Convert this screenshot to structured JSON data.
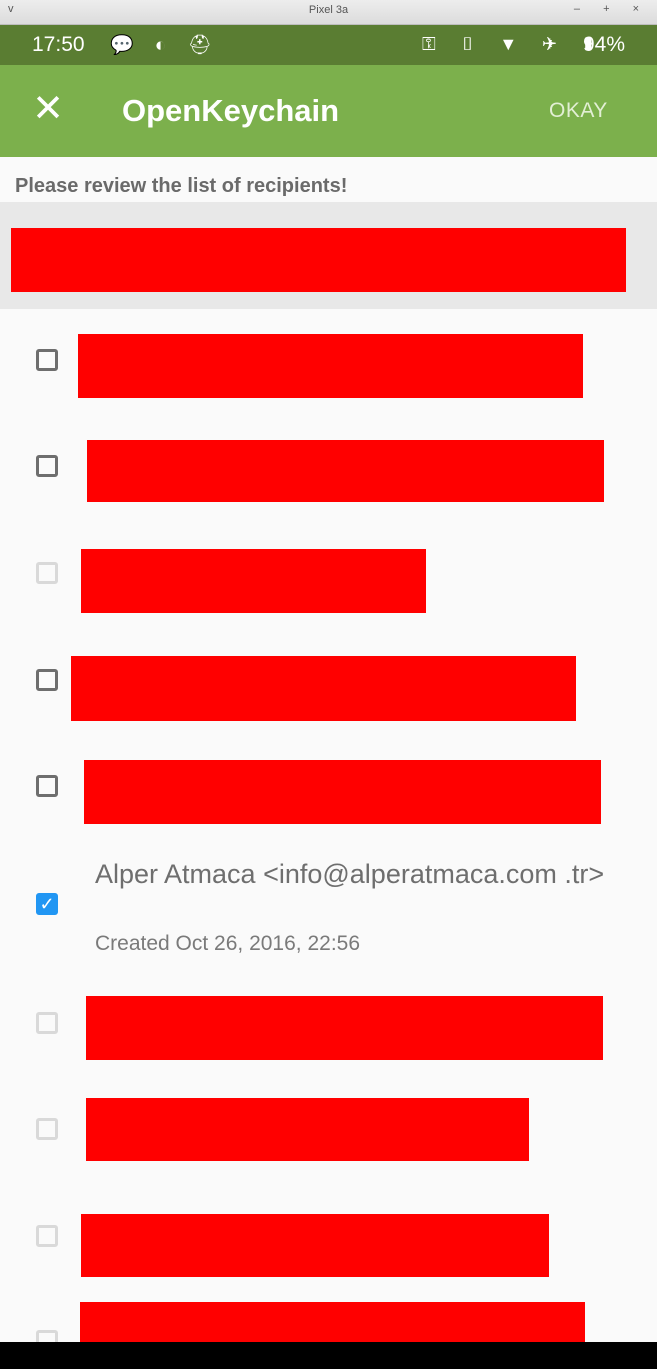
{
  "window": {
    "title": "Pixel 3a",
    "menu_glyph": "v",
    "controls": "– + ×"
  },
  "status": {
    "time": "17:50",
    "left_icons": "💬 ◐ ⛑",
    "right_icons": "⚿ ▯ ▼ ✈ ▮",
    "battery": "94%"
  },
  "app_bar": {
    "close_glyph": "✕",
    "title": "OpenKeychain",
    "okay_label": "OKAY"
  },
  "notice": "Please review the list of recipients!",
  "recipient": {
    "name": "Alper Atmaca <info@alperatmaca.com .tr>",
    "created": "Created Oct 26, 2016, 22:56",
    "check_glyph": "✓"
  },
  "colors": {
    "status_bar": "#5a7d32",
    "app_bar": "#7cb04c",
    "redaction": "#ff0000",
    "checkbox_checked": "#2196f3"
  }
}
